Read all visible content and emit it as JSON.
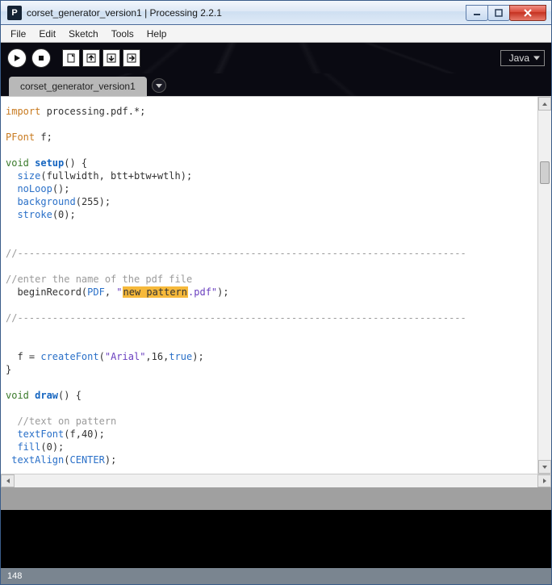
{
  "window": {
    "title": "corset_generator_version1 | Processing 2.2.1",
    "app_icon_letter": "P"
  },
  "menus": {
    "file": "File",
    "edit": "Edit",
    "sketch": "Sketch",
    "tools": "Tools",
    "help": "Help"
  },
  "toolbar": {
    "mode_label": "Java"
  },
  "tab": {
    "name": "corset_generator_version1"
  },
  "code": {
    "l1a": "import",
    "l1b": " processing.pdf.*;",
    "l3a": "PFont",
    "l3b": " f;",
    "l5a": "void ",
    "l5b": "setup",
    "l5c": "() {",
    "l6a": "  ",
    "l6b": "size",
    "l6c": "(fullwidth, btt+btw+wtlh);",
    "l7a": "  ",
    "l7b": "noLoop",
    "l7c": "();",
    "l8a": "  ",
    "l8b": "background",
    "l8c": "(",
    "l8d": "255",
    "l8e": ");",
    "l9a": "  ",
    "l9b": "stroke",
    "l9c": "(",
    "l9d": "0",
    "l9e": ");",
    "sep1": "//-----------------------------------------------------------------------------",
    "cmt1": "//enter the name of the pdf file",
    "l14a": "  beginRecord(",
    "l14b": "PDF",
    "l14c": ", ",
    "l14d": "\"",
    "l14e": "new pattern",
    "l14f": ".pdf\"",
    "l14g": ");",
    "sep2": "//-----------------------------------------------------------------------------",
    "l18a": "  f = ",
    "l18b": "createFont",
    "l18c": "(",
    "l18d": "\"Arial\"",
    "l18e": ",",
    "l18f": "16",
    "l18g": ",",
    "l18h": "true",
    "l18i": ");",
    "l19": "}",
    "l21a": "void ",
    "l21b": "draw",
    "l21c": "() {",
    "cmt2": "  //text on pattern",
    "l24a": "  ",
    "l24b": "textFont",
    "l24c": "(f,",
    "l24d": "40",
    "l24e": ");",
    "l25a": "  ",
    "l25b": "fill",
    "l25c": "(",
    "l25d": "0",
    "l25e": ");",
    "l26a": " ",
    "l26b": "textAlign",
    "l26c": "(",
    "l26d": "CENTER",
    "l26e": ");"
  },
  "status": {
    "line": "148"
  }
}
